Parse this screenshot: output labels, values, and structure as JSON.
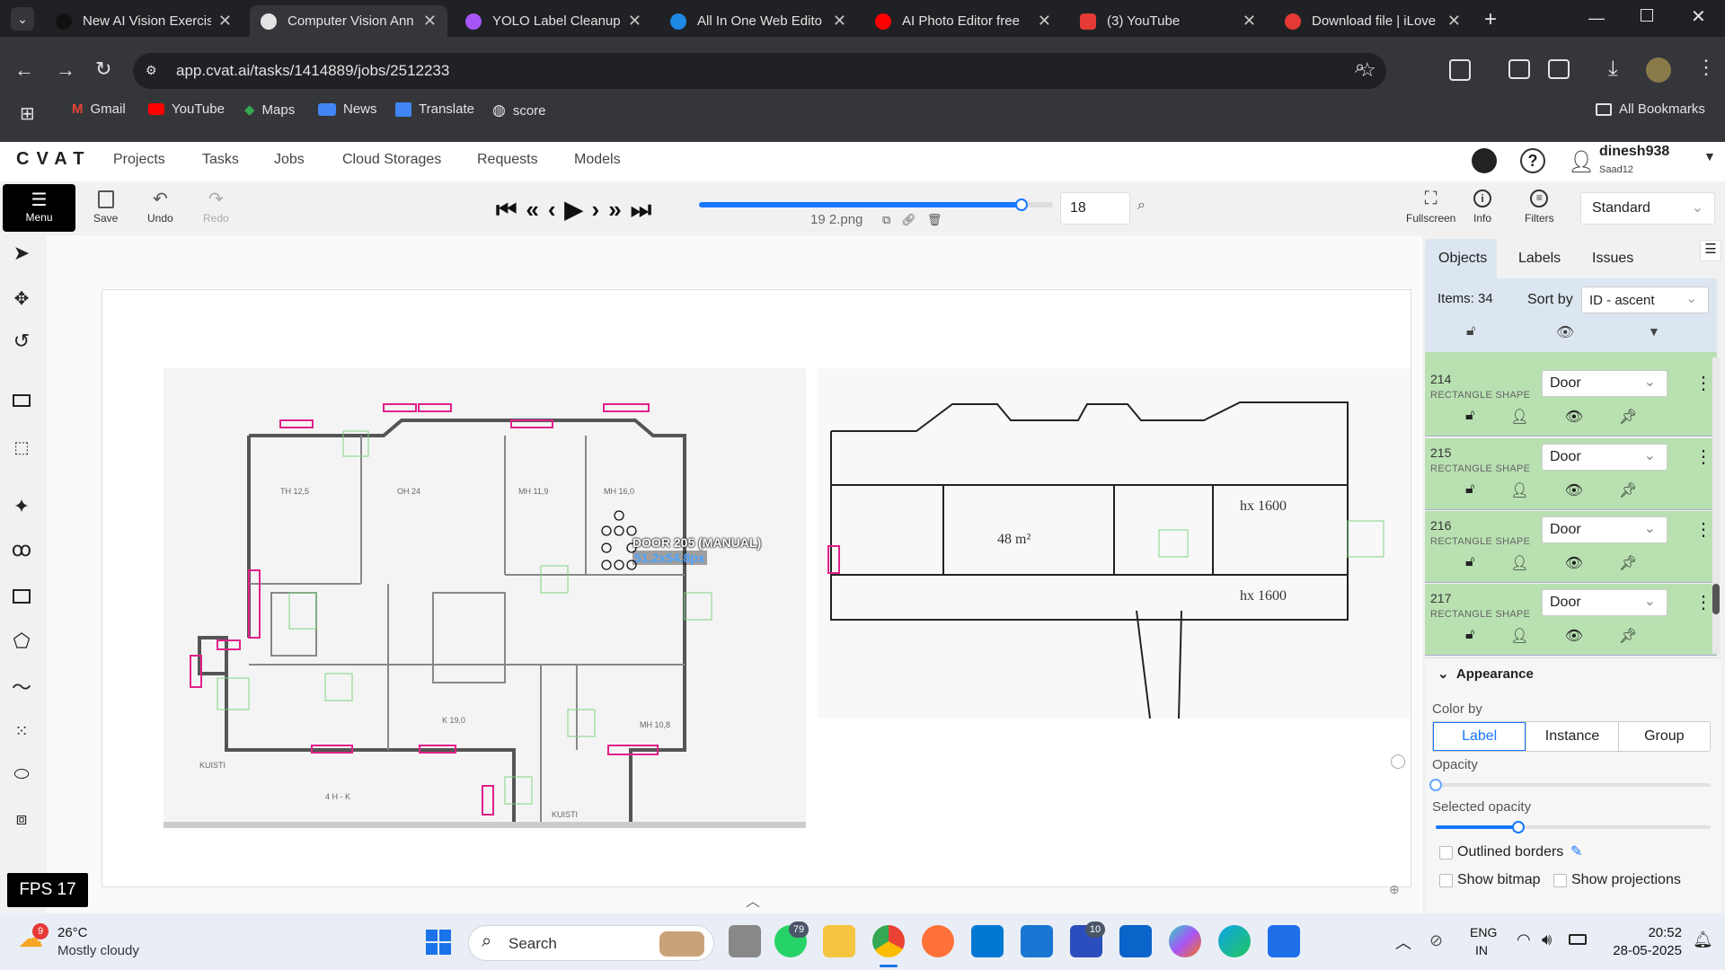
{
  "browser": {
    "tabs": [
      {
        "title": "New AI Vision Exercis",
        "color": "#4a8af4"
      },
      {
        "title": "Computer Vision Ann",
        "color": "#111111"
      },
      {
        "title": "YOLO Label Cleanup",
        "color": "#e3e3e3"
      },
      {
        "title": "All In One Web Edito",
        "color": "#a855f7"
      },
      {
        "title": "AI Photo Editor free",
        "color": "#1e88e5"
      },
      {
        "title": "(3) YouTube",
        "color": "#ff0000"
      },
      {
        "title": "Download file | iLove",
        "color": "#e53935"
      }
    ],
    "url": "app.cvat.ai/tasks/1414889/jobs/2512233",
    "bookmarks": [
      "Gmail",
      "YouTube",
      "Maps",
      "News",
      "Translate",
      "score"
    ],
    "all_bookmarks": "All Bookmarks"
  },
  "app": {
    "logo": "CVAT",
    "nav": [
      "Projects",
      "Tasks",
      "Jobs",
      "Cloud Storages",
      "Requests",
      "Models"
    ],
    "user": {
      "name": "dinesh938",
      "org": "Saad12"
    }
  },
  "toolbar": {
    "menu": "Menu",
    "save": "Save",
    "undo": "Undo",
    "redo": "Redo",
    "frame_number": "18",
    "filename": "19 2.png",
    "frame_progress": 0.91,
    "fullscreen": "Fullscreen",
    "info": "Info",
    "filters": "Filters",
    "workspace": "Standard"
  },
  "canvas": {
    "shape_label": "DOOR 205 (MANUAL)",
    "shape_size": "51.2x54.8px",
    "fps": "FPS 17"
  },
  "sidebar": {
    "tabs": [
      "Objects",
      "Labels",
      "Issues"
    ],
    "items_count": "Items: 34",
    "sort_by_label": "Sort by",
    "sort_by_value": "ID - ascent",
    "objects": [
      {
        "id": "214",
        "type": "RECTANGLE SHAPE",
        "label": "Door"
      },
      {
        "id": "215",
        "type": "RECTANGLE SHAPE",
        "label": "Door"
      },
      {
        "id": "216",
        "type": "RECTANGLE SHAPE",
        "label": "Door"
      },
      {
        "id": "217",
        "type": "RECTANGLE SHAPE",
        "label": "Door"
      }
    ],
    "appearance": {
      "title": "Appearance",
      "color_by": "Color by",
      "color_options": [
        "Label",
        "Instance",
        "Group"
      ],
      "opacity": "Opacity",
      "opacity_value": 0.0,
      "selected_opacity": "Selected opacity",
      "selected_opacity_value": 0.3,
      "outlined_borders": "Outlined borders",
      "show_bitmap": "Show bitmap",
      "show_projections": "Show projections"
    }
  },
  "taskbar": {
    "temp": "26°C",
    "weather": "Mostly cloudy",
    "weather_badge": "9",
    "search": "Search",
    "whatsapp_badge": "79",
    "teams_badge": "10",
    "lang1": "ENG",
    "lang2": "IN",
    "time": "20:52",
    "date": "28-05-2025"
  }
}
